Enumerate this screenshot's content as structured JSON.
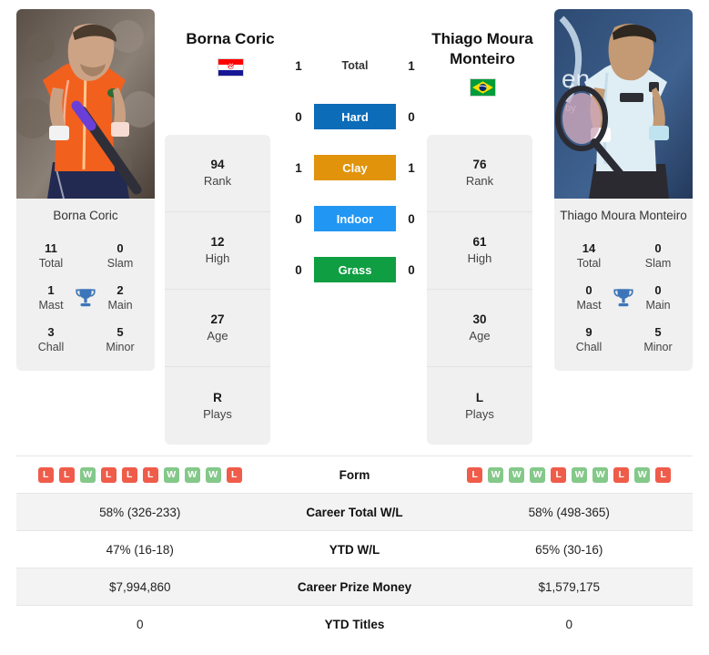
{
  "players": {
    "left": {
      "name": "Borna Coric",
      "card_name": "Borna Coric",
      "country": "Croatia",
      "flag": "croatia-flag",
      "titles": {
        "total": "11",
        "total_label": "Total",
        "slam": "0",
        "slam_label": "Slam",
        "mast": "1",
        "mast_label": "Mast",
        "main": "2",
        "main_label": "Main",
        "chall": "3",
        "chall_label": "Chall",
        "minor": "5",
        "minor_label": "Minor"
      },
      "stats": [
        {
          "value": "94",
          "label": "Rank"
        },
        {
          "value": "12",
          "label": "High"
        },
        {
          "value": "27",
          "label": "Age"
        },
        {
          "value": "R",
          "label": "Plays"
        }
      ],
      "form": [
        "L",
        "L",
        "W",
        "L",
        "L",
        "L",
        "W",
        "W",
        "W",
        "L"
      ],
      "career_total_wl": "58% (326-233)",
      "ytd_wl": "47% (16-18)",
      "career_prize_money": "$7,994,860",
      "ytd_titles": "0"
    },
    "right": {
      "name": "Thiago Moura Monteiro",
      "card_name": "Thiago Moura Monteiro",
      "country": "Brazil",
      "flag": "brazil-flag",
      "titles": {
        "total": "14",
        "total_label": "Total",
        "slam": "0",
        "slam_label": "Slam",
        "mast": "0",
        "mast_label": "Mast",
        "main": "0",
        "main_label": "Main",
        "chall": "9",
        "chall_label": "Chall",
        "minor": "5",
        "minor_label": "Minor"
      },
      "stats": [
        {
          "value": "76",
          "label": "Rank"
        },
        {
          "value": "61",
          "label": "High"
        },
        {
          "value": "30",
          "label": "Age"
        },
        {
          "value": "L",
          "label": "Plays"
        }
      ],
      "form": [
        "L",
        "W",
        "W",
        "W",
        "L",
        "W",
        "W",
        "L",
        "W",
        "L"
      ],
      "career_total_wl": "58% (498-365)",
      "ytd_wl": "65% (30-16)",
      "career_prize_money": "$1,579,175",
      "ytd_titles": "0"
    }
  },
  "head_to_head": [
    {
      "label": "Total",
      "left": "1",
      "right": "1",
      "color": "transparent",
      "plain": true
    },
    {
      "label": "Hard",
      "left": "0",
      "right": "0",
      "color": "#0c6cb8"
    },
    {
      "label": "Clay",
      "left": "1",
      "right": "1",
      "color": "#e0930b"
    },
    {
      "label": "Indoor",
      "left": "0",
      "right": "0",
      "color": "#2196f3"
    },
    {
      "label": "Grass",
      "left": "0",
      "right": "0",
      "color": "#0f9e41"
    }
  ],
  "comparison_rows": [
    {
      "label": "Form",
      "left": "",
      "right": "",
      "type": "form"
    },
    {
      "label": "Career Total W/L",
      "left": "58% (326-233)",
      "right": "58% (498-365)",
      "type": "text"
    },
    {
      "label": "YTD W/L",
      "left": "47% (16-18)",
      "right": "65% (30-16)",
      "type": "text"
    },
    {
      "label": "Career Prize Money",
      "left": "$7,994,860",
      "right": "$1,579,175",
      "type": "text"
    },
    {
      "label": "YTD Titles",
      "left": "0",
      "right": "0",
      "type": "text"
    }
  ],
  "colors": {
    "hard": "#0c6cb8",
    "clay": "#e0930b",
    "indoor": "#2196f3",
    "grass": "#0f9e41",
    "win": "#84c88a",
    "loss": "#ef5c4a",
    "trophy": "#3d76b8",
    "panel": "#f0f0f0"
  }
}
